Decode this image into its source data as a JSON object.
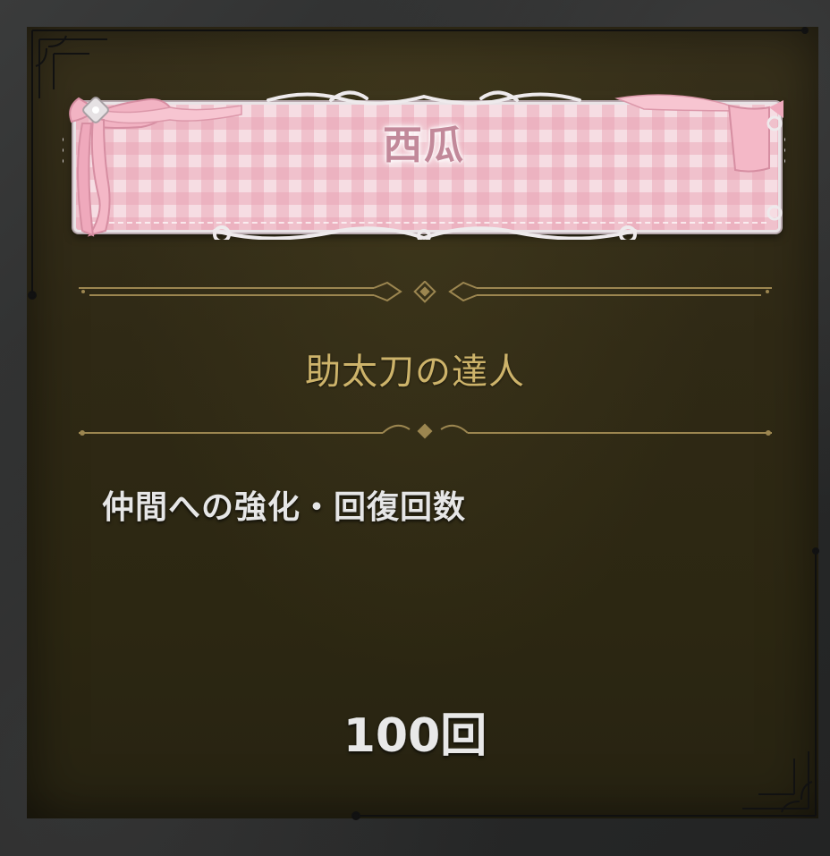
{
  "plate": {
    "name": "西瓜",
    "icon": "bow-ribbon-icon"
  },
  "achievement": {
    "title": "助太刀の達人",
    "condition": "仲間への強化・回復回数",
    "count": "100回"
  },
  "colors": {
    "panel_bg": "#2f2915",
    "gold_text": "#cdb36a",
    "gold_line": "#9c8650",
    "pink_plate": "#f6dde3",
    "pink_check": "#e8a0b0",
    "name_text": "#c2899a",
    "body_text": "#e6e6e6"
  }
}
